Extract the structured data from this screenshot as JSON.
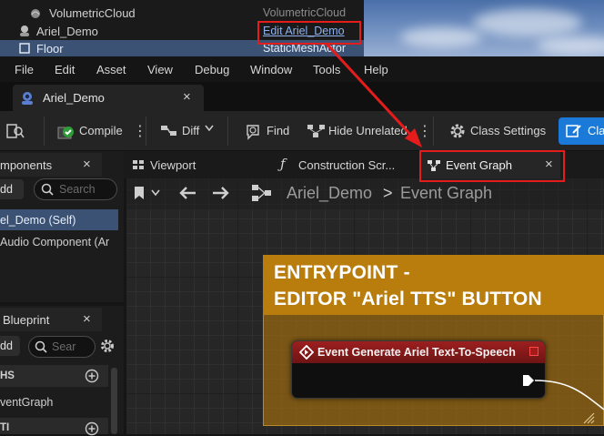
{
  "outliner": {
    "rows": [
      {
        "name": "VolumetricCloud",
        "type": "VolumetricCloud"
      },
      {
        "name": "Ariel_Demo",
        "type": "Edit Ariel_Demo"
      },
      {
        "name": "Floor",
        "type": "StaticMeshActor"
      }
    ]
  },
  "menubar": {
    "items": [
      "File",
      "Edit",
      "Asset",
      "View",
      "Debug",
      "Window",
      "Tools",
      "Help"
    ]
  },
  "doc_tab": {
    "label": "Ariel_Demo",
    "close": "×"
  },
  "toolbar": {
    "compile": "Compile",
    "diff": "Diff",
    "find": "Find",
    "hide_unrelated": "Hide Unrelated",
    "class_settings": "Class Settings",
    "class_defaults_partial": "Cla"
  },
  "components_panel": {
    "title": "mponents",
    "add": "dd",
    "search_placeholder": "Search",
    "items": [
      "el_Demo (Self)",
      "Audio Component (Ar"
    ]
  },
  "blueprint_panel": {
    "title": "Blueprint",
    "add": "dd",
    "search_placeholder": "Sear",
    "section_graphs": "HS",
    "event_graph_item": "ventGraph",
    "section_functions": "TI"
  },
  "editor_tabs": {
    "viewport": "Viewport",
    "construction": "Construction Scr...",
    "event_graph": "Event Graph",
    "close": "×"
  },
  "graph_breadcrumb": {
    "root": "Ariel_Demo",
    "separator": ">",
    "current": "Event Graph"
  },
  "comment": {
    "line1": "ENTRYPOINT -",
    "line2": "EDITOR \"Ariel TTS\" BUTTON"
  },
  "event_node": {
    "title": "Event Generate Ariel Text-To-Speech"
  },
  "colors": {
    "highlight": "#e41c1c",
    "selection": "#3b5274",
    "comment": "#b97d0e",
    "event_header": "#9c1f1f"
  }
}
